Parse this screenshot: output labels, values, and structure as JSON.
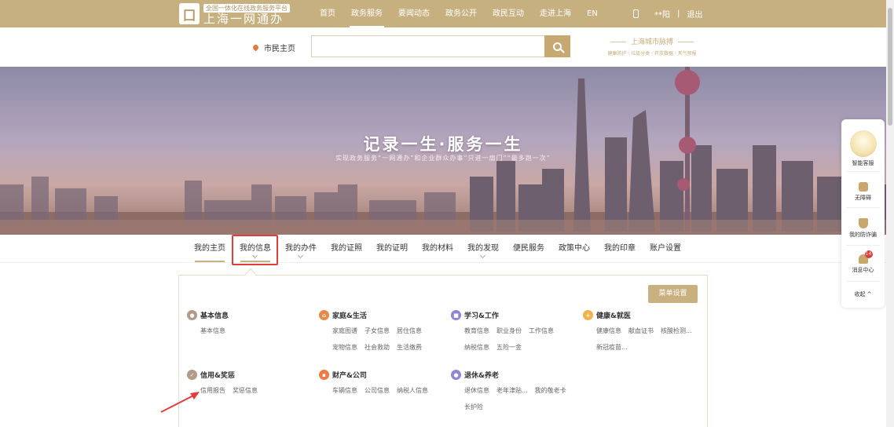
{
  "header": {
    "logo_slogan": "全国一体化在线政务服务平台",
    "logo_name": "上海一网通办",
    "logo_badge": "囗",
    "nav": [
      "首页",
      "政务服务",
      "要闻动态",
      "政务公开",
      "政民互动",
      "走进上海",
      "EN"
    ],
    "active_nav": "政务服务",
    "user": "**阳",
    "logout": "退出",
    "sep": "|"
  },
  "search": {
    "location": "市民主页",
    "placeholder": "",
    "pulse_title": "上海城市脉搏",
    "pulse_sub": "健康防护 · 垃圾分类 · 开放数据 · 天气预报"
  },
  "banner": {
    "title": "记录一生·服务一生",
    "subtitle": "实现政务服务“一网通办”和企业群众办事“只进一扇门”“最多跑一次”"
  },
  "tabs": [
    {
      "label": "我的主页",
      "chev": false
    },
    {
      "label": "我的信息",
      "chev": true
    },
    {
      "label": "我的办件",
      "chev": true
    },
    {
      "label": "我的证照",
      "chev": false
    },
    {
      "label": "我的证明",
      "chev": false
    },
    {
      "label": "我的材料",
      "chev": false
    },
    {
      "label": "我的发现",
      "chev": true
    },
    {
      "label": "便民服务",
      "chev": false
    },
    {
      "label": "政策中心",
      "chev": false
    },
    {
      "label": "我的印章",
      "chev": false
    },
    {
      "label": "账户设置",
      "chev": false
    }
  ],
  "panel": {
    "menu_settings": "菜单设置",
    "categories": [
      {
        "title": "基本信息",
        "color": "#b39a88",
        "links": [
          "基本信息"
        ]
      },
      {
        "title": "家庭&生活",
        "color": "#e78a47",
        "links": [
          "家庭图谱",
          "子女信息",
          "居住信息",
          "宠物信息",
          "社会救助",
          "生活缴费"
        ]
      },
      {
        "title": "学习&工作",
        "color": "#8f86d8",
        "links": [
          "教育信息",
          "职业身份",
          "工作信息",
          "纳税信息",
          "五险一金"
        ]
      },
      {
        "title": "健康&就医",
        "color": "#f0b24d",
        "links": [
          "健康信息",
          "献血证书",
          "核酸检测...",
          "新冠疫苗..."
        ]
      },
      {
        "title": "信用&奖惩",
        "color": "#b39a88",
        "links": [
          "信用报告",
          "奖惩信息"
        ]
      },
      {
        "title": "财产&公司",
        "color": "#ef7a45",
        "links": [
          "车辆信息",
          "公司信息",
          "纳税人信息"
        ]
      },
      {
        "title": "退休&养老",
        "color": "#8f86d8",
        "links": [
          "退休信息",
          "老年津贴...",
          "我的敬老卡",
          "长护险"
        ]
      }
    ]
  },
  "float_widget": {
    "assistant": "智能客服",
    "accessibility": "无障碍",
    "anti_fraud": "我的防诈骗",
    "messages": "消息中心",
    "message_count": "14",
    "collapse": "收起 ^"
  }
}
